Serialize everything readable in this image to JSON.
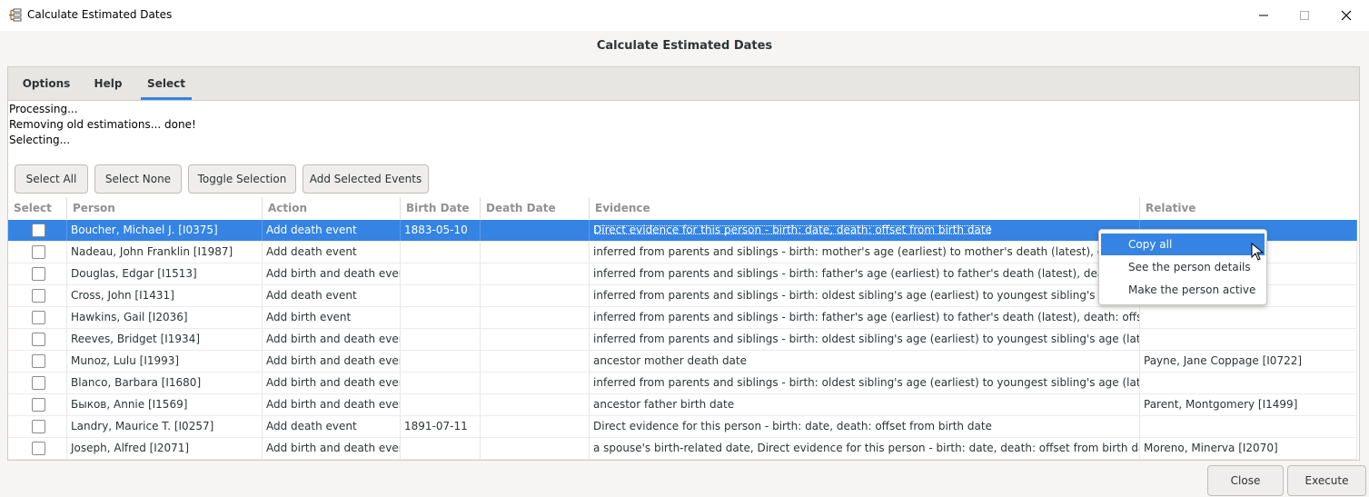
{
  "window": {
    "title": "Calculate Estimated Dates",
    "controls": [
      "minimize-icon",
      "maximize-icon",
      "close-icon"
    ]
  },
  "header": {
    "title": "Calculate Estimated Dates"
  },
  "tabs": [
    {
      "label": "Options",
      "active": false
    },
    {
      "label": "Help",
      "active": false
    },
    {
      "label": "Select",
      "active": true
    }
  ],
  "status_lines": [
    "Processing...",
    "Removing old estimations... done!",
    "Selecting..."
  ],
  "toolbar": {
    "select_all": "Select All",
    "select_none": "Select None",
    "toggle_selection": "Toggle Selection",
    "add_selected": "Add Selected Events"
  },
  "table": {
    "columns": [
      "Select",
      "Person",
      "Action",
      "Birth Date",
      "Death Date",
      "Evidence",
      "Relative"
    ],
    "rows": [
      {
        "person": "Boucher, Michael J. [I0375]",
        "action": "Add death event",
        "birth": "1883-05-10",
        "death": "",
        "evidence": "Direct evidence for this person - birth: date, death: offset from birth date",
        "relative": "",
        "selected": true
      },
      {
        "person": "Nadeau, John Franklin [I1987]",
        "action": "Add death event",
        "birth": "",
        "death": "",
        "evidence": "inferred from parents and siblings - birth: mother's age (earliest) to mother's death (latest), death: offset fro",
        "relative": "",
        "selected": false
      },
      {
        "person": "Douglas, Edgar [I1513]",
        "action": "Add birth and death events",
        "birth": "",
        "death": "",
        "evidence": "inferred from parents and siblings - birth: father's age (earliest) to father's death (latest), death: offset from",
        "relative": "",
        "selected": false
      },
      {
        "person": "Cross, John [I1431]",
        "action": "Add death event",
        "birth": "",
        "death": "",
        "evidence": "inferred from parents and siblings - birth: oldest sibling's age (earliest) to youngest sibling's age (latest), de",
        "relative": "",
        "selected": false
      },
      {
        "person": "Hawkins, Gail [I2036]",
        "action": "Add birth event",
        "birth": "",
        "death": "",
        "evidence": "inferred from parents and siblings - birth: father's age (earliest) to father's death (latest), death: offset from birth da",
        "relative": "",
        "selected": false
      },
      {
        "person": "Reeves, Bridget [I1934]",
        "action": "Add birth and death events",
        "birth": "",
        "death": "",
        "evidence": "inferred from parents and siblings - birth: oldest sibling's age (earliest) to youngest sibling's age (latest), death: off",
        "relative": "",
        "selected": false
      },
      {
        "person": "Munoz, Lulu [I1993]",
        "action": "Add birth and death events",
        "birth": "",
        "death": "",
        "evidence": "ancestor mother death date",
        "relative": "Payne, Jane Coppage [I0722]",
        "selected": false
      },
      {
        "person": "Blanco, Barbara [I1680]",
        "action": "Add birth and death events",
        "birth": "",
        "death": "",
        "evidence": "inferred from parents and siblings - birth: oldest sibling's age (earliest) to youngest sibling's age (latest), death: off",
        "relative": "",
        "selected": false
      },
      {
        "person": "Быков, Annie [I1569]",
        "action": "Add birth and death events",
        "birth": "",
        "death": "",
        "evidence": "ancestor father birth date",
        "relative": "Parent, Montgomery [I1499]",
        "selected": false
      },
      {
        "person": "Landry, Maurice T. [I0257]",
        "action": "Add death event",
        "birth": "1891-07-11",
        "death": "",
        "evidence": "Direct evidence for this person - birth: date, death: offset from birth date",
        "relative": "",
        "selected": false
      },
      {
        "person": "Joseph, Alfred [I2071]",
        "action": "Add birth and death events",
        "birth": "",
        "death": "",
        "evidence": "a spouse's birth-related date, Direct evidence for this person - birth: date, death: offset from birth date",
        "relative": "Moreno, Minerva [I2070]",
        "selected": false
      }
    ]
  },
  "context_menu": {
    "items": [
      "Copy all",
      "See the person details",
      "Make the person active"
    ],
    "highlighted": 0
  },
  "footer": {
    "close": "Close",
    "execute": "Execute"
  },
  "colors": {
    "accent": "#3584e4",
    "background": "#f6f5f4"
  }
}
